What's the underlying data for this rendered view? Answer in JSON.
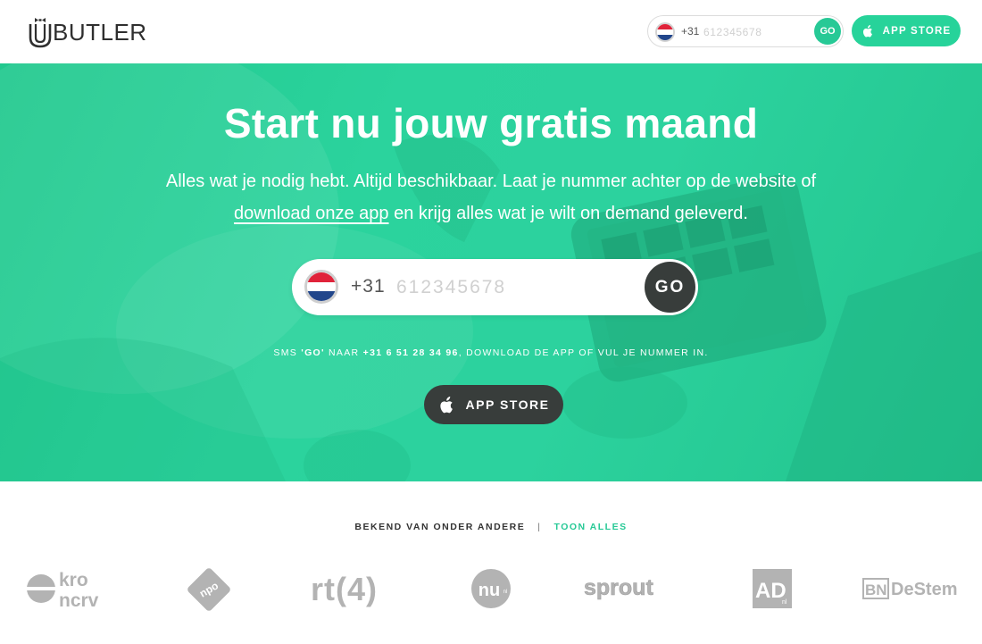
{
  "header": {
    "logo_text": "BUTLER",
    "phone": {
      "prefix": "+31",
      "placeholder": "612345678",
      "go_label": "GO"
    },
    "app_store_label": "APP STORE"
  },
  "hero": {
    "title": "Start nu jouw gratis maand",
    "subtitle_before": "Alles wat je nodig hebt. Altijd beschikbaar. Laat je nummer achter op de website of",
    "subtitle_link": "download onze app",
    "subtitle_after": "en krijg alles wat je wilt on demand geleverd.",
    "phone": {
      "prefix": "+31",
      "placeholder": "612345678",
      "go_label": "GO"
    },
    "sms_pre": "SMS ",
    "sms_keyword": "'GO'",
    "sms_mid": " NAAR ",
    "sms_number": "+31 6 51 28 34 96",
    "sms_post": ", DOWNLOAD DE APP OF VUL JE NUMMER IN.",
    "app_store_label": "APP STORE"
  },
  "press": {
    "label": "BEKEND VAN ONDER ANDERE",
    "separator": "|",
    "show_all": "TOON ALLES",
    "logos": [
      {
        "name": "kro-ncrv",
        "line1": "kro",
        "line2": "ncrv"
      },
      {
        "name": "npo",
        "text": "npo"
      },
      {
        "name": "rtl4",
        "text": "rt(4)"
      },
      {
        "name": "nu",
        "text": "nu",
        "sup": "nl"
      },
      {
        "name": "sprout",
        "text": "sprout"
      },
      {
        "name": "ad",
        "text": "AD",
        "sup": "nl"
      },
      {
        "name": "bndestem",
        "box": "BN",
        "text": "DeStem"
      }
    ]
  },
  "colors": {
    "brand_green": "#27c996",
    "hero_green": "#2bd39d",
    "dark_button": "#383d3b",
    "logo_grey": "#b3b3b3"
  },
  "icons": [
    "apple-icon",
    "netherlands-flag-icon",
    "bow-tie-icon"
  ]
}
